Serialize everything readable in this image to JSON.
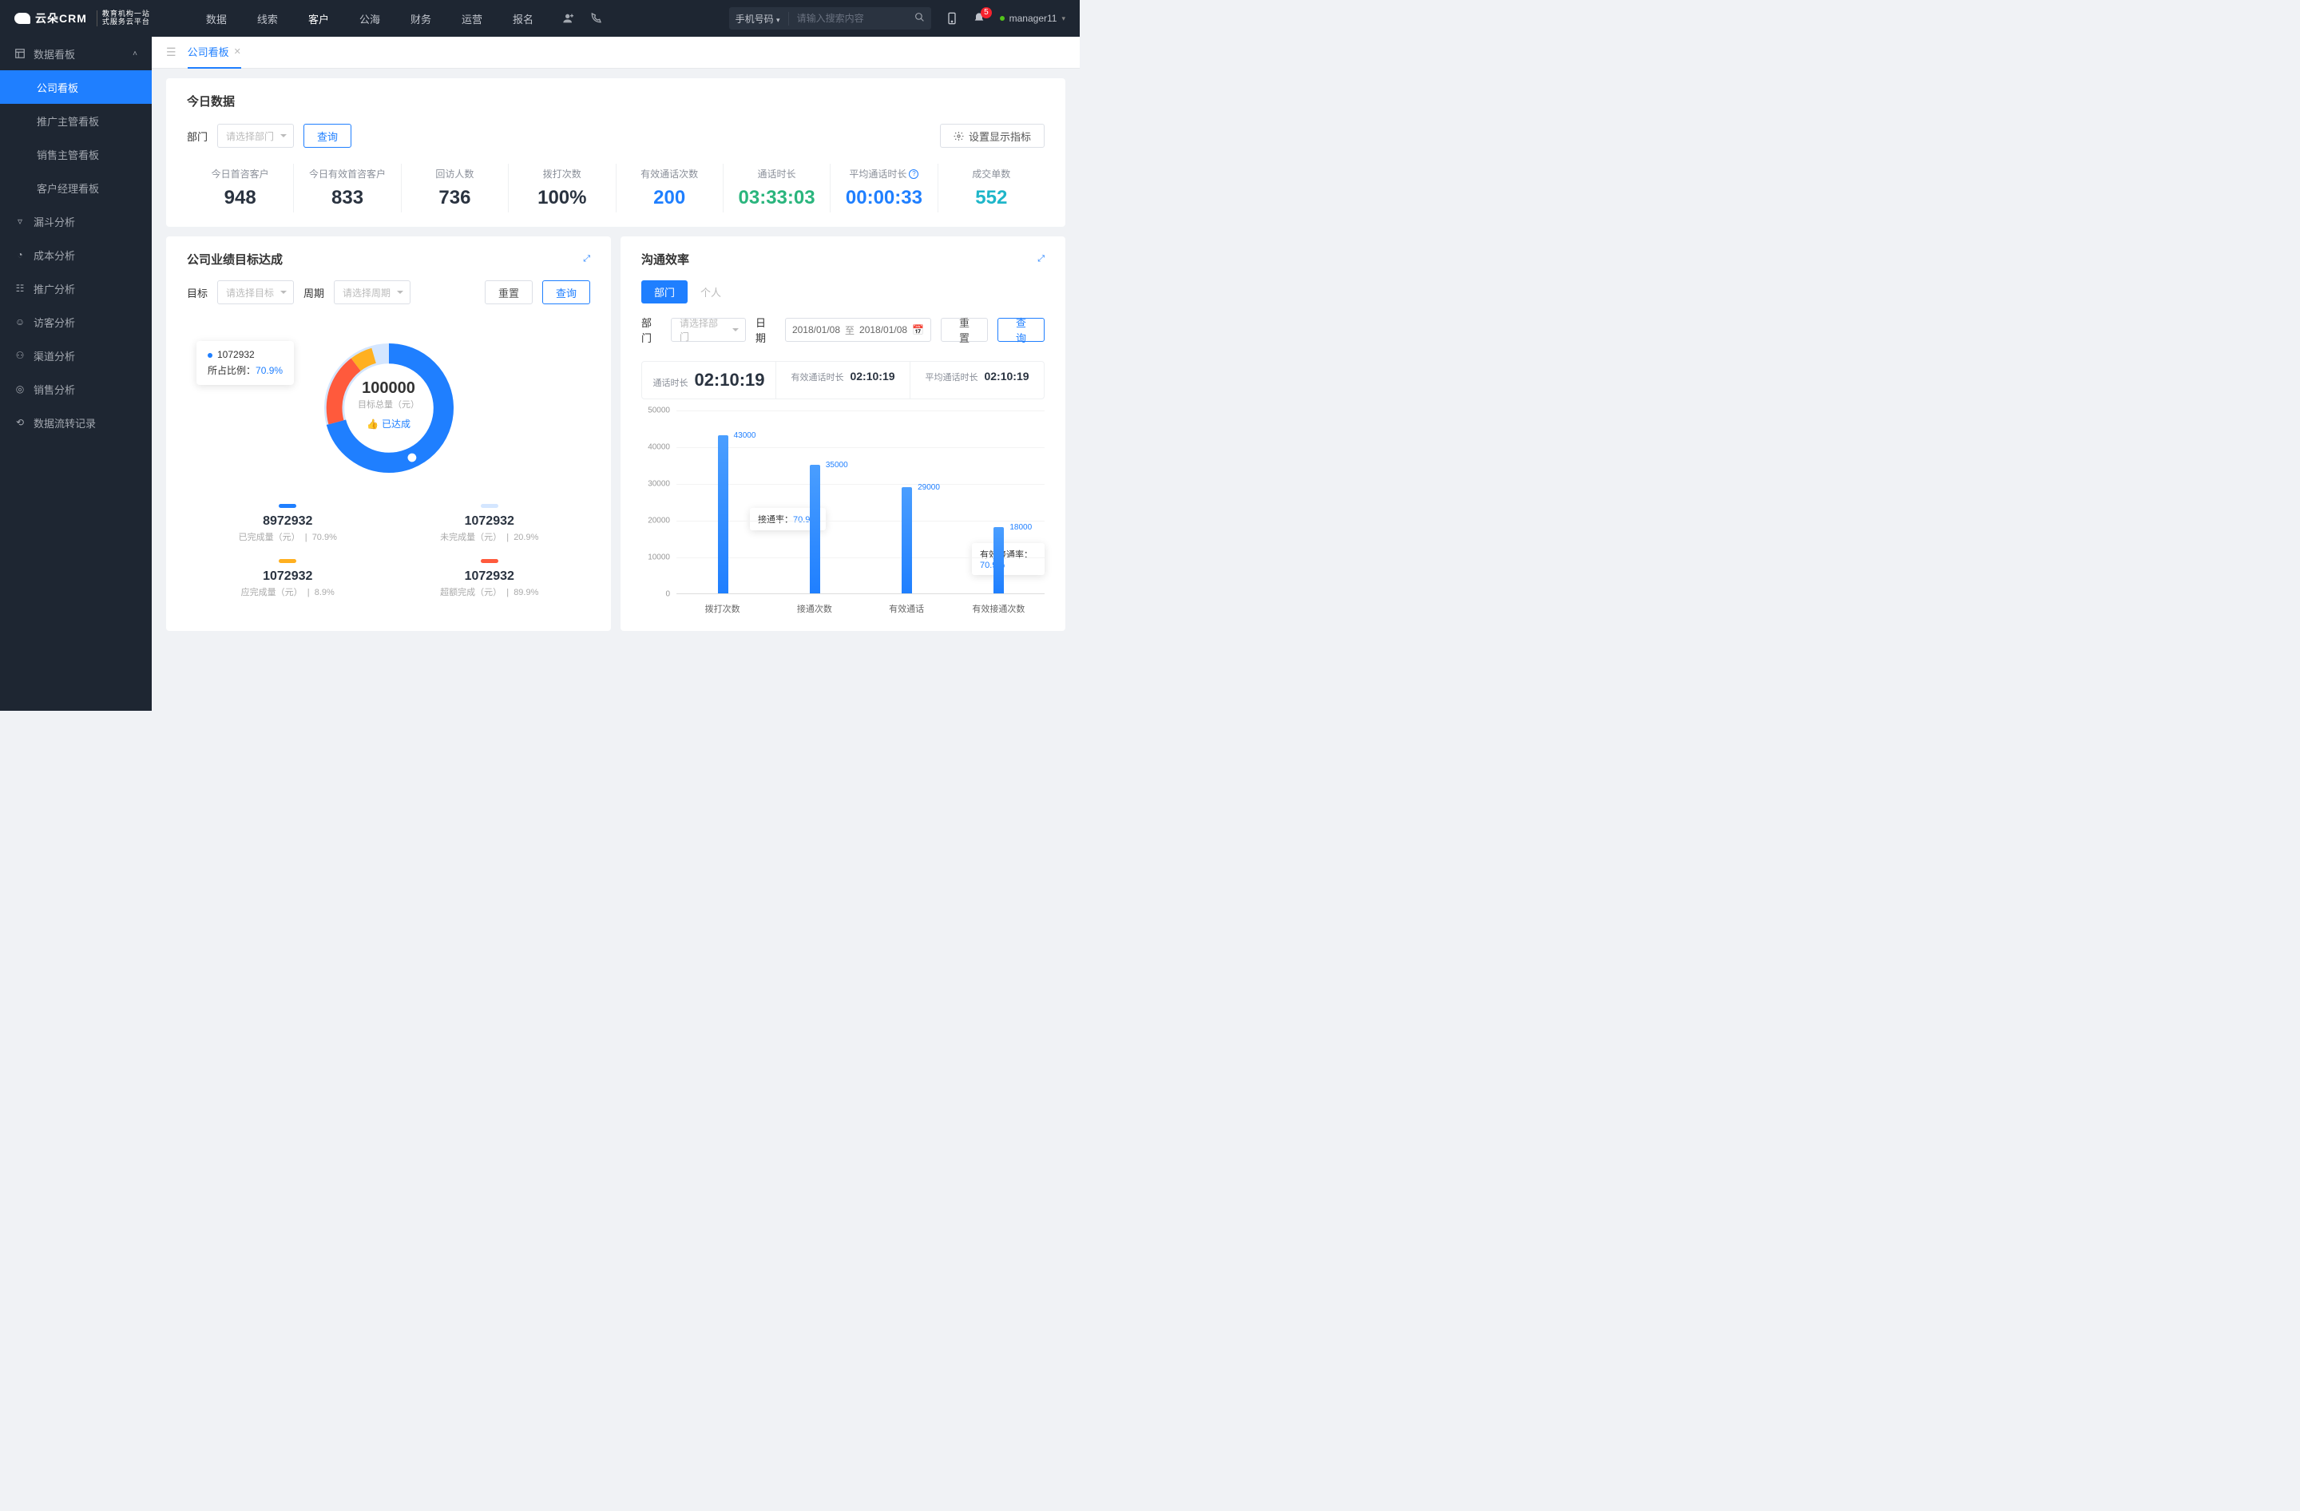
{
  "header": {
    "brand": "云朵CRM",
    "brand_sub1": "教育机构一站",
    "brand_sub2": "式服务云平台",
    "nav": [
      "数据",
      "线索",
      "客户",
      "公海",
      "财务",
      "运营",
      "报名"
    ],
    "nav_active": 2,
    "search_type": "手机号码",
    "search_placeholder": "请输入搜索内容",
    "badge": "5",
    "username": "manager11"
  },
  "sidebar": {
    "group": "数据看板",
    "sub": [
      "公司看板",
      "推广主管看板",
      "销售主管看板",
      "客户经理看板"
    ],
    "sub_active": 0,
    "items": [
      "漏斗分析",
      "成本分析",
      "推广分析",
      "访客分析",
      "渠道分析",
      "销售分析",
      "数据流转记录"
    ]
  },
  "tab": {
    "label": "公司看板"
  },
  "today": {
    "title": "今日数据",
    "dept_label": "部门",
    "dept_placeholder": "请选择部门",
    "query": "查询",
    "setting": "设置显示指标",
    "stats": [
      {
        "label": "今日首咨客户",
        "value": "948",
        "cls": "c-dark"
      },
      {
        "label": "今日有效首咨客户",
        "value": "833",
        "cls": "c-dark"
      },
      {
        "label": "回访人数",
        "value": "736",
        "cls": "c-dark"
      },
      {
        "label": "拨打次数",
        "value": "100%",
        "cls": "c-dark"
      },
      {
        "label": "有效通话次数",
        "value": "200",
        "cls": "c-blue"
      },
      {
        "label": "通话时长",
        "value": "03:33:03",
        "cls": "c-green"
      },
      {
        "label": "平均通话时长",
        "value": "00:00:33",
        "cls": "c-blue",
        "info": true
      },
      {
        "label": "成交单数",
        "value": "552",
        "cls": "c-cyan"
      }
    ]
  },
  "goal": {
    "title": "公司业绩目标达成",
    "target_label": "目标",
    "target_placeholder": "请选择目标",
    "period_label": "周期",
    "period_placeholder": "请选择周期",
    "reset": "重置",
    "query": "查询",
    "tooltip_value": "1072932",
    "tooltip_ratio_label": "所占比例：",
    "tooltip_ratio": "70.9%",
    "center_value": "100000",
    "center_label": "目标总量（元）",
    "achieved": "已达成",
    "legend": [
      {
        "color": "#1f7fff",
        "value": "8972932",
        "label": "已完成量（元）",
        "pct": "70.9%"
      },
      {
        "color": "#d4e6ff",
        "value": "1072932",
        "label": "未完成量（元）",
        "pct": "20.9%"
      },
      {
        "color": "#ffb020",
        "value": "1072932",
        "label": "应完成量（元）",
        "pct": "8.9%"
      },
      {
        "color": "#ff5a3c",
        "value": "1072932",
        "label": "超额完成（元）",
        "pct": "89.9%"
      }
    ]
  },
  "comm": {
    "title": "沟通效率",
    "tabs": [
      "部门",
      "个人"
    ],
    "dept_label": "部门",
    "dept_placeholder": "请选择部门",
    "date_label": "日期",
    "date_from": "2018/01/08",
    "date_sep": "至",
    "date_to": "2018/01/08",
    "reset": "重置",
    "query": "查询",
    "summary": [
      {
        "label": "通话时长",
        "value": "02:10:19",
        "big": true
      },
      {
        "label": "有效通话时长",
        "value": "02:10:19"
      },
      {
        "label": "平均通话时长",
        "value": "02:10:19"
      }
    ],
    "tip1_label": "接通率：",
    "tip1_val": "70.9%",
    "tip2_label": "有效接通率：",
    "tip2_val": "70.9%"
  },
  "chart_data": {
    "type": "bar",
    "categories": [
      "拨打次数",
      "接通次数",
      "有效通话",
      "有效接通次数"
    ],
    "values": [
      43000,
      35000,
      29000,
      18000
    ],
    "ylabel": "",
    "ylim": [
      0,
      50000
    ],
    "yticks": [
      0,
      10000,
      20000,
      30000,
      40000,
      50000
    ]
  }
}
